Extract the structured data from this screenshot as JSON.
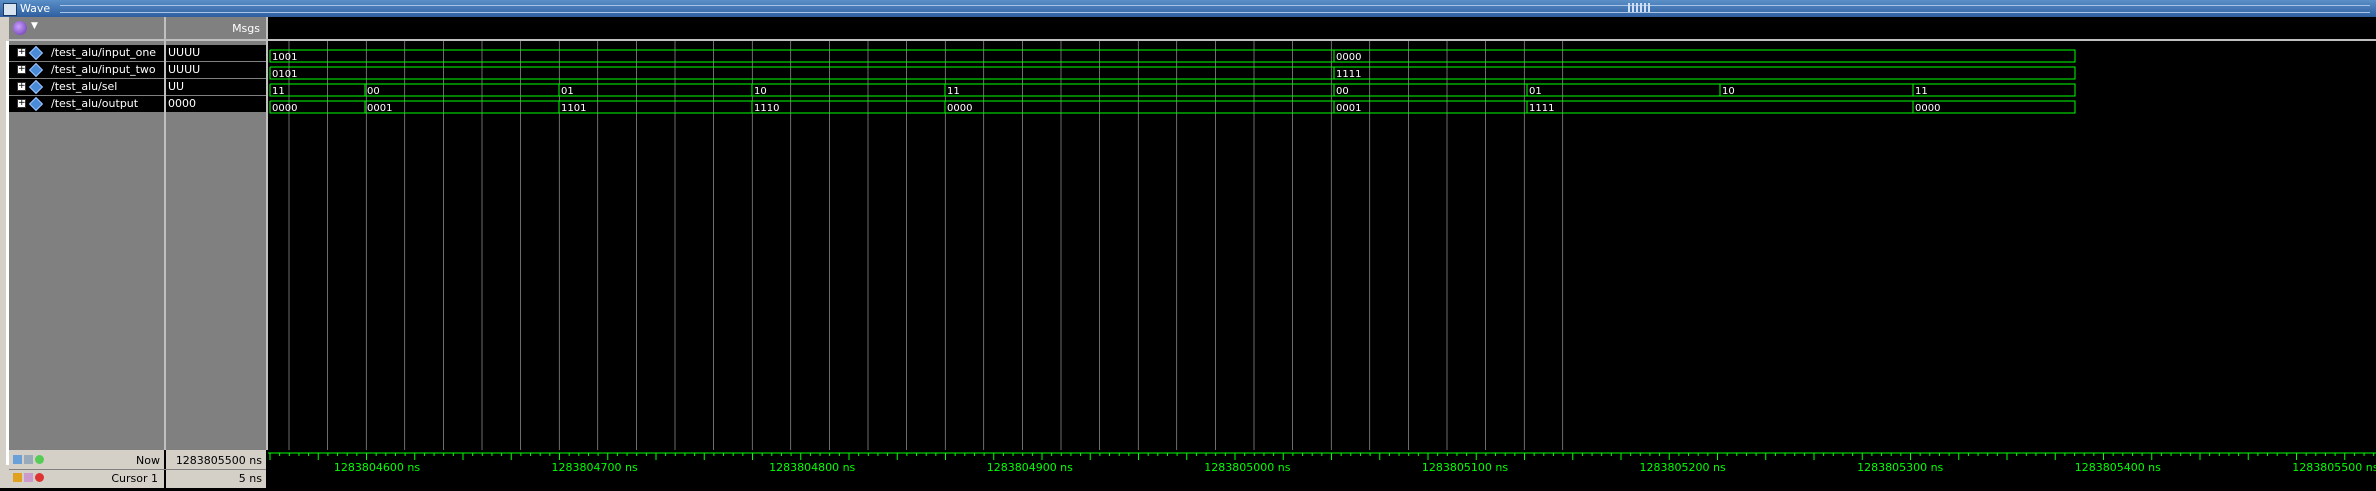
{
  "window": {
    "title": "Wave"
  },
  "header": {
    "msgs_label": "Msgs"
  },
  "signals": [
    {
      "name": "/test_alu/input_one",
      "value": "UUUU"
    },
    {
      "name": "/test_alu/input_two",
      "value": "UUUU"
    },
    {
      "name": "/test_alu/sel",
      "value": "UU"
    },
    {
      "name": "/test_alu/output",
      "value": "0000"
    }
  ],
  "wave_values": [
    [
      "1001",
      "0000"
    ],
    [
      "0101",
      "1111"
    ],
    [
      "11",
      "00",
      "01",
      "10",
      "11",
      "00",
      "01",
      "10",
      "11"
    ],
    [
      "0000",
      "0001",
      "1101",
      "1110",
      "0000",
      "0001",
      "1111",
      "0000"
    ]
  ],
  "status": {
    "now_label": "Now",
    "now_value": "1283805500 ns",
    "cursor_label": "Cursor 1",
    "cursor_value": "5 ns"
  },
  "timeline": {
    "labels": [
      "1283804600 ns",
      "1283804700 ns",
      "1283804800 ns",
      "1283804900 ns",
      "1283805000 ns",
      "1283805100 ns",
      "1283805200 ns",
      "1283805300 ns",
      "1283805400 ns",
      "1283805500 ns"
    ]
  },
  "colors": {
    "wave": "#00ff00",
    "grid": "#ffffff",
    "time_text": "#00ff00"
  }
}
